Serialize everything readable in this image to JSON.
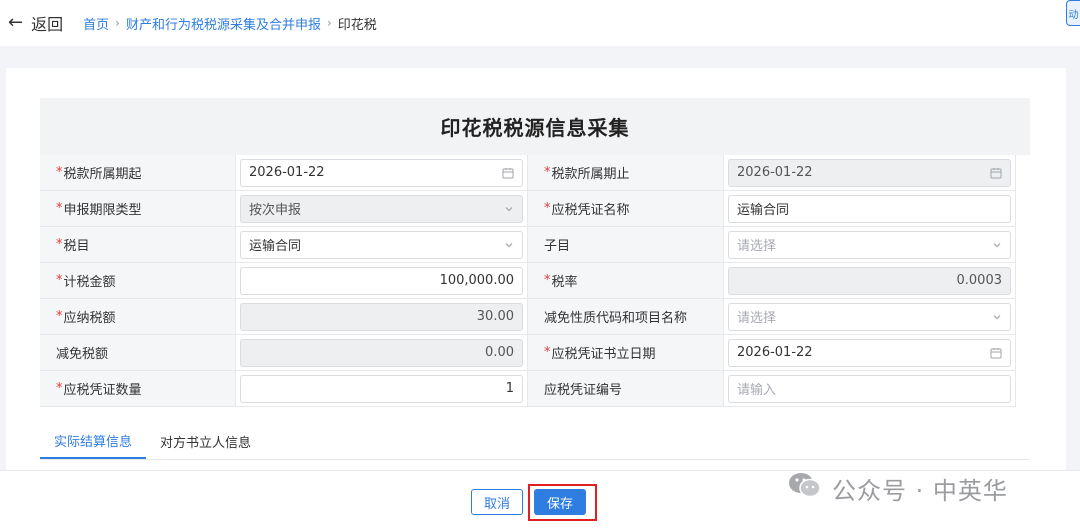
{
  "header": {
    "back_label": "返回",
    "breadcrumbs": [
      "首页",
      "财产和行为税税源采集及合并申报"
    ],
    "current": "印花税",
    "corner_badge": "动"
  },
  "form": {
    "title": "印花税税源信息采集",
    "required_mark": "*",
    "rows": [
      {
        "left": {
          "label": "税款所属期起",
          "required": true,
          "value": "2026-01-22",
          "kind": "date",
          "disabled": false
        },
        "right": {
          "label": "税款所属期止",
          "required": true,
          "value": "2026-01-22",
          "kind": "date",
          "disabled": true
        }
      },
      {
        "left": {
          "label": "申报期限类型",
          "required": true,
          "value": "按次申报",
          "kind": "select",
          "disabled": true
        },
        "right": {
          "label": "应税凭证名称",
          "required": true,
          "value": "运输合同",
          "kind": "text",
          "disabled": false
        }
      },
      {
        "left": {
          "label": "税目",
          "required": true,
          "value": "运输合同",
          "kind": "select",
          "disabled": false
        },
        "right": {
          "label": "子目",
          "required": false,
          "value": "",
          "placeholder": "请选择",
          "kind": "select",
          "disabled": false
        }
      },
      {
        "left": {
          "label": "计税金额",
          "required": true,
          "value": "100,000.00",
          "kind": "number",
          "disabled": false
        },
        "right": {
          "label": "税率",
          "required": true,
          "value": "0.0003",
          "kind": "number",
          "disabled": true
        }
      },
      {
        "left": {
          "label": "应纳税额",
          "required": true,
          "value": "30.00",
          "kind": "number",
          "disabled": true
        },
        "right": {
          "label": "减免性质代码和项目名称",
          "required": false,
          "value": "",
          "placeholder": "请选择",
          "kind": "select",
          "disabled": false
        }
      },
      {
        "left": {
          "label": "减免税额",
          "required": false,
          "value": "0.00",
          "kind": "number",
          "disabled": true
        },
        "right": {
          "label": "应税凭证书立日期",
          "required": true,
          "value": "2026-01-22",
          "kind": "date",
          "disabled": false
        }
      },
      {
        "left": {
          "label": "应税凭证数量",
          "required": true,
          "value": "1",
          "kind": "number",
          "disabled": false
        },
        "right": {
          "label": "应税凭证编号",
          "required": false,
          "value": "",
          "placeholder": "请输入",
          "kind": "text",
          "disabled": false
        }
      }
    ]
  },
  "tabs": [
    {
      "label": "实际结算信息",
      "active": true
    },
    {
      "label": "对方书立人信息",
      "active": false
    }
  ],
  "footer": {
    "cancel_label": "取消",
    "save_label": "保存"
  },
  "watermark": {
    "text": "公众号 · 中英华",
    "icon": "wechat-icon"
  },
  "colors": {
    "accent": "#2f7de1",
    "required": "#e4393c",
    "highlight": "#e02020"
  }
}
